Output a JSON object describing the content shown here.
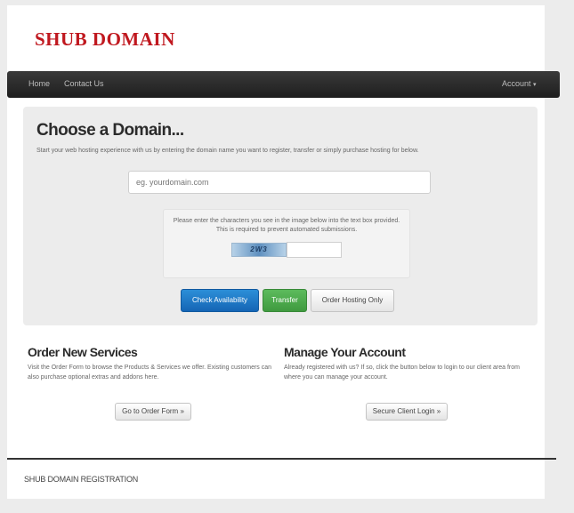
{
  "brand": {
    "name": "SHUB DOMAIN"
  },
  "navbar": {
    "items": [
      "Home",
      "Contact Us"
    ],
    "account_label": "Account"
  },
  "hero": {
    "title": "Choose a Domain...",
    "intro": "Start your web hosting experience with us by entering the domain name you want to register, transfer or simply purchase hosting for below.",
    "domain_placeholder": "eg. yourdomain.com",
    "captcha_instructions": "Please enter the characters you see in the image below into the text box provided. This is required to prevent automated submissions.",
    "captcha_code": "2W3",
    "buttons": {
      "check": "Check Availability",
      "transfer": "Transfer",
      "hosting": "Order Hosting Only"
    }
  },
  "order_services": {
    "title": "Order New Services",
    "text": "Visit the Order Form to browse the Products & Services we offer. Existing customers can also purchase optional extras and addons here.",
    "button": "Go to Order Form »"
  },
  "manage_account": {
    "title": "Manage Your Account",
    "text": "Already registered with us? If so, click the button below to login to our client area from where you can manage your account.",
    "button": "Secure Client Login »"
  },
  "footer": {
    "text": "SHUB DOMAIN REGISTRATION"
  },
  "colors": {
    "brand": "#c0181f",
    "primary": "#1565b5",
    "success": "#3f9a3f",
    "navbar": "#2a2a2a"
  }
}
